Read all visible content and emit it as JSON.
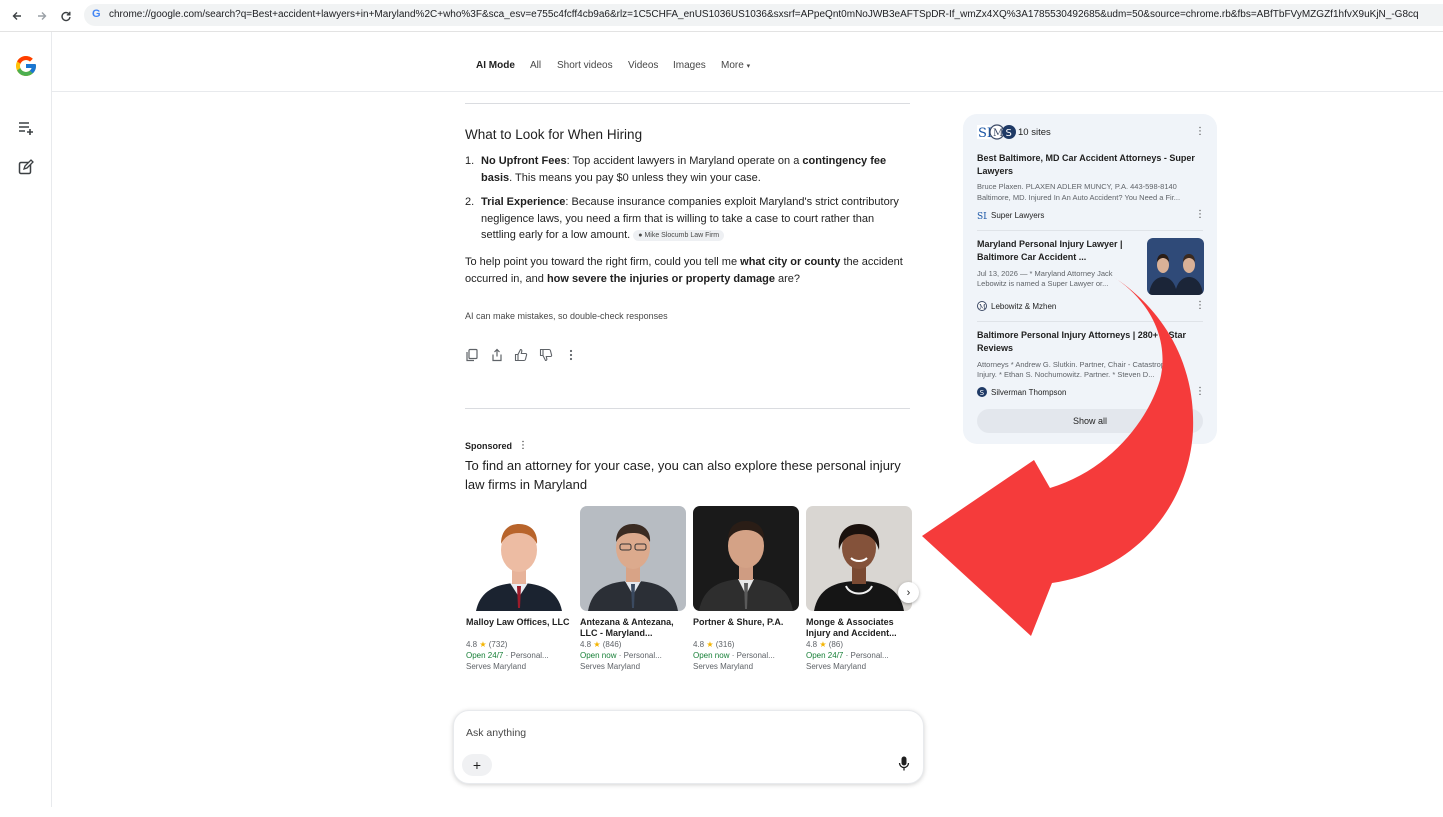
{
  "browser": {
    "url": "chrome://google.com/search?q=Best+accident+lawyers+in+Maryland%2C+who%3F&sca_esv=e755c4fcff4cb9a6&rlz=1C5CHFA_enUS1036US1036&sxsrf=APpeQnt0mNoJWB3eAFTSpDR-If_wmZx4XQ%3A1785530492685&udm=50&source=chrome.rb&fbs=ABfTbFVyMZGZf1hfvX9uKjN_-G8cq"
  },
  "icons": {
    "back": "back-arrow-icon",
    "forward": "forward-arrow-icon",
    "reload": "reload-icon",
    "rail_history": "history-list-icon",
    "rail_new_chat": "new-chat-icon"
  },
  "tabs": [
    "AI Mode",
    "All",
    "Short videos",
    "Videos",
    "Images",
    "More"
  ],
  "answer": {
    "heading": "What to Look for When Hiring",
    "items": [
      {
        "num": "1.",
        "bold": "No Upfront Fees",
        "text_a": ": Top accident lawyers in Maryland operate on a ",
        "bold2": "contingency fee basis",
        "text_b": ". This means you pay $0 unless they win your case."
      },
      {
        "num": "2.",
        "bold": "Trial Experience",
        "text_a": ": Because insurance companies exploit Maryland's strict contributory negligence laws, you need a firm that is willing to take a case to court rather than settling early for a low amount.",
        "chip": "Mike Slocumb Law Firm"
      }
    ],
    "followup_a": "To help point you toward the right firm, could you tell me ",
    "followup_b1": "what city or county",
    "followup_c": " the accident occurred in, and ",
    "followup_b2": "how severe the injuries or property damage",
    "followup_d": " are?",
    "disclaimer": "AI can make mistakes, so double-check responses"
  },
  "sponsored": {
    "label": "Sponsored",
    "heading": "To find an attorney for your case, you can also explore these personal injury law firms in Maryland",
    "cards": [
      {
        "name": "Malloy Law Offices, LLC",
        "rating": "4.8",
        "reviews": "(732)",
        "hours": "Open 24/7",
        "category": "Personal...",
        "area": "Serves Maryland"
      },
      {
        "name": "Antezana & Antezana, LLC - Maryland...",
        "rating": "4.8",
        "reviews": "(846)",
        "hours": "Open now",
        "category": "Personal...",
        "area": "Serves Maryland"
      },
      {
        "name": "Portner & Shure, P.A.",
        "rating": "4.8",
        "reviews": "(316)",
        "hours": "Open now",
        "category": "Personal...",
        "area": "Serves Maryland"
      },
      {
        "name": "Monge & Associates Injury and Accident...",
        "rating": "4.8",
        "reviews": "(86)",
        "hours": "Open 24/7",
        "category": "Personal...",
        "area": "Serves Maryland"
      }
    ]
  },
  "input": {
    "placeholder": "Ask anything",
    "plus": "+"
  },
  "sources": {
    "count": "10 sites",
    "items": [
      {
        "title": "Best Baltimore, MD Car Accident Attorneys - Super Lawyers",
        "snippet1": "Bruce Plaxen. PLAXEN ADLER MUNCY, P.A. 443-598-8140",
        "snippet2": "Baltimore, MD. Injured In An Auto Accident? You Need a Fir...",
        "site": "Super Lawyers"
      },
      {
        "title": "Maryland Personal Injury Lawyer | Baltimore Car Accident ...",
        "snippet1": "Jul 13, 2026 — * Maryland Attorney Jack",
        "snippet2": "Lebowitz is named a Super Lawyer or...",
        "site": "Lebowitz & Mzhen"
      },
      {
        "title": "Baltimore Personal Injury Attorneys | 280+ 5-Star Reviews",
        "snippet1": "Attorneys * Andrew G. Slutkin. Partner, Chair - Catastrophic",
        "snippet2": "Injury. * Ethan S. Nochumowitz. Partner. * Steven D...",
        "site": "Silverman Thompson"
      }
    ],
    "show_all": "Show all"
  },
  "colors": {
    "annotation_arrow": "#f53b3b",
    "open_green": "#188038",
    "star": "#f4b400"
  }
}
